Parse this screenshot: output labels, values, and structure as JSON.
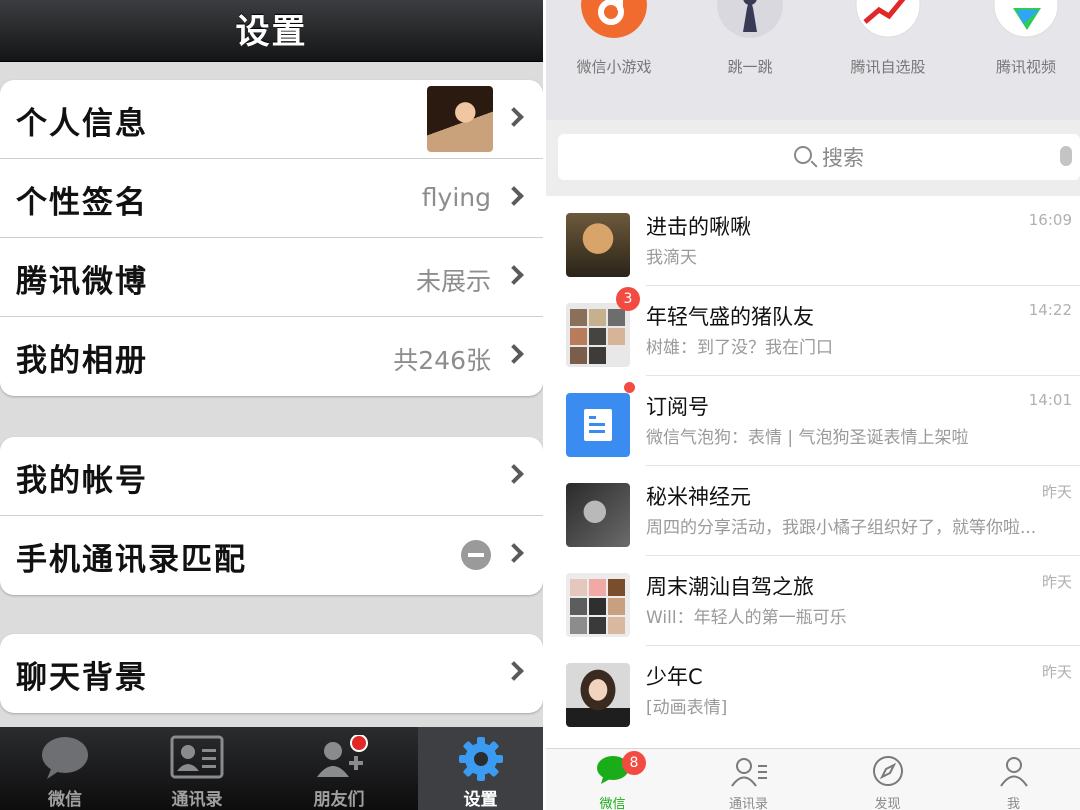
{
  "left": {
    "title": "设置",
    "groups": [
      {
        "cells": [
          {
            "label": "个人信息",
            "value": ""
          },
          {
            "label": "个性签名",
            "value": "flying"
          },
          {
            "label": "腾讯微博",
            "value": "未展示"
          },
          {
            "label": "我的相册",
            "value": "共246张"
          }
        ]
      },
      {
        "cells": [
          {
            "label": "我的帐号",
            "value": ""
          },
          {
            "label": "手机通讯录匹配",
            "value": ""
          }
        ]
      },
      {
        "cells": [
          {
            "label": "聊天背景",
            "value": ""
          }
        ]
      }
    ],
    "tabs": [
      {
        "label": "微信",
        "icon": "chat-bubble-icon"
      },
      {
        "label": "通讯录",
        "icon": "contact-card-icon"
      },
      {
        "label": "朋友们",
        "icon": "add-friend-icon"
      },
      {
        "label": "设置",
        "icon": "gear-icon",
        "active": true
      }
    ]
  },
  "right": {
    "apps": [
      {
        "label": "微信小游戏",
        "color": "#f26b2e"
      },
      {
        "label": "跳一跳",
        "color": "#c9c9d3"
      },
      {
        "label": "腾讯自选股",
        "color": "#ffffff"
      },
      {
        "label": "腾讯视频",
        "color": "#ffffff"
      }
    ],
    "search": {
      "placeholder": "搜索"
    },
    "chats": [
      {
        "name": "进击的啾啾",
        "message": "我滴天",
        "time": "16:09",
        "badge": ""
      },
      {
        "name": "年轻气盛的猪队友",
        "message": "树雄：到了没？我在门口",
        "time": "14:22",
        "badge": "3"
      },
      {
        "name": "订阅号",
        "message": "微信气泡狗：表情 | 气泡狗圣诞表情上架啦",
        "time": "14:01",
        "badge": ""
      },
      {
        "name": "秘米神经元",
        "message": "周四的分享活动，我跟小橘子组织好了，就等你啦...",
        "time": "昨天",
        "badge": ""
      },
      {
        "name": "周末潮汕自驾之旅",
        "message": "Will：年轻人的第一瓶可乐",
        "time": "昨天",
        "badge": ""
      },
      {
        "name": "少年C",
        "message": "[动画表情]",
        "time": "昨天",
        "badge": ""
      }
    ],
    "tabs": [
      {
        "label": "微信",
        "badge": "8",
        "active": true
      },
      {
        "label": "通讯录"
      },
      {
        "label": "发现"
      },
      {
        "label": "我"
      }
    ],
    "accent": "#1aad19",
    "badge_color": "#f24c42"
  }
}
